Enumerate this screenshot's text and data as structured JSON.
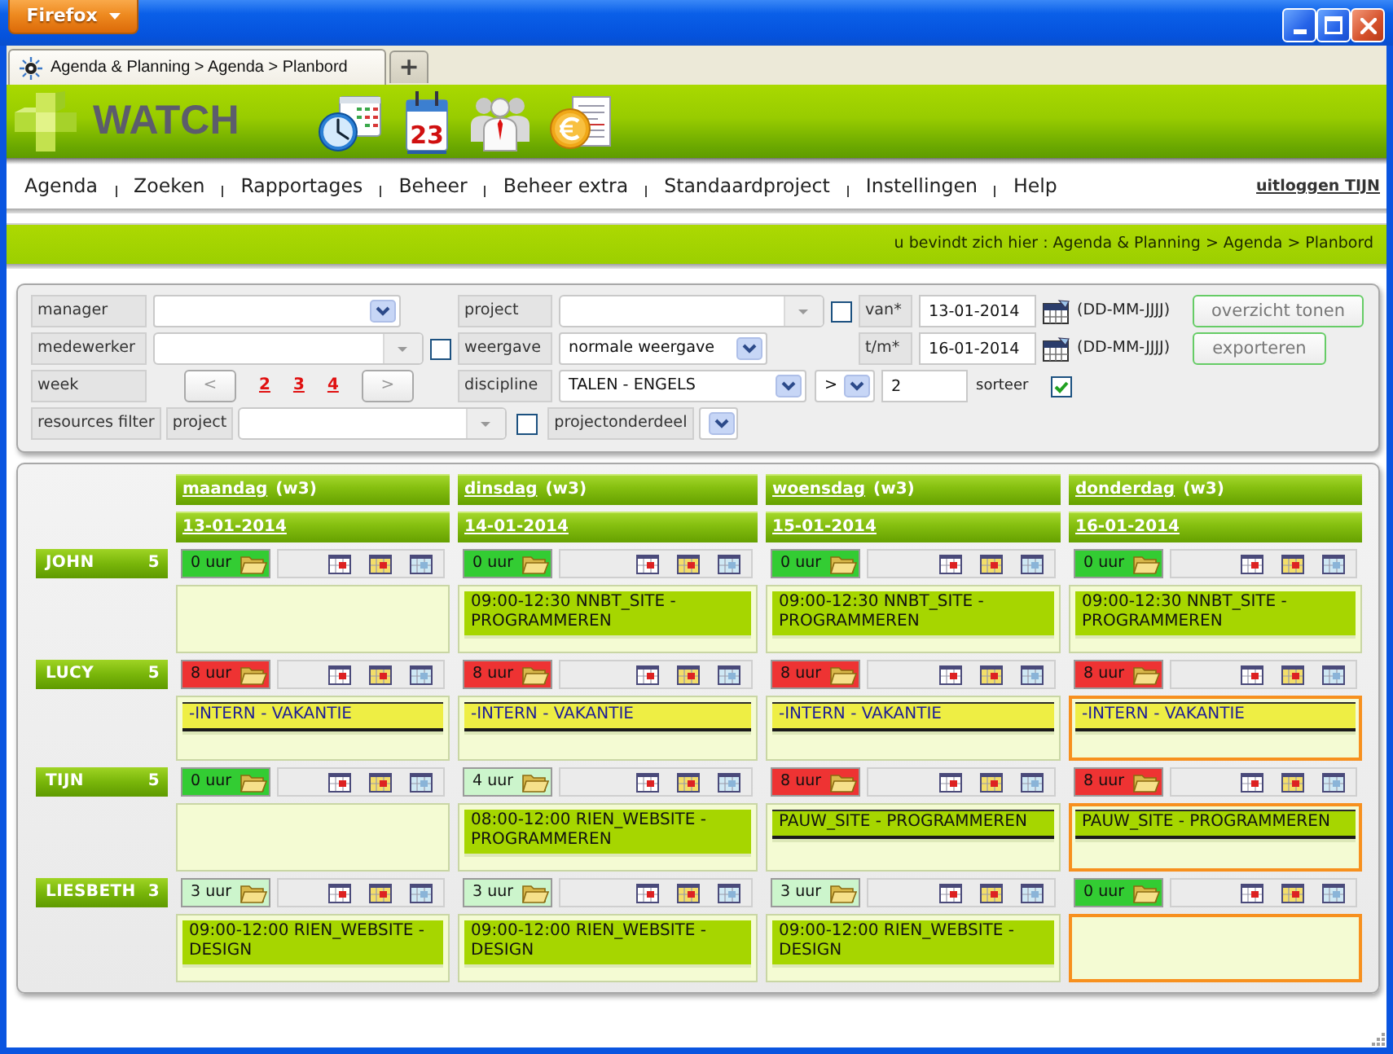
{
  "window": {
    "menu_button": "Firefox"
  },
  "browser_tab": {
    "title": "Agenda & Planning > Agenda > Planbord",
    "new_tab": "+"
  },
  "header": {
    "logo": "WATCH",
    "calendar_day": "23"
  },
  "nav": {
    "items": [
      "Agenda",
      "Zoeken",
      "Rapportages",
      "Beheer",
      "Beheer extra",
      "Standaardproject",
      "Instellingen",
      "Help"
    ],
    "logout": "uitloggen TIJN"
  },
  "breadcrumb": "u bevindt zich hier : Agenda & Planning > Agenda > Planbord",
  "filters": {
    "manager": {
      "label": "manager",
      "kind": "dropdown"
    },
    "employee": {
      "label": "medewerker",
      "kind": "combobox",
      "checked": false
    },
    "week": {
      "label": "week",
      "prev": "<",
      "next": ">",
      "pages": [
        "2",
        "3",
        "4"
      ]
    },
    "resources_filter": {
      "label": "resources filter",
      "project": {
        "label": "project",
        "kind": "combobox",
        "checked": false
      },
      "part": {
        "label": "projectonderdeel",
        "kind": "dropdown"
      }
    },
    "project": {
      "label": "project",
      "kind": "combobox",
      "checked": false
    },
    "view": {
      "label": "weergave",
      "kind": "dropdown",
      "value": "normale weergave"
    },
    "discipline": {
      "label": "discipline",
      "kind": "dropdown",
      "value": "TALEN - ENGELS",
      "operator": ">",
      "count": "2",
      "sort_label": "sorteer",
      "sort_checked": true
    },
    "date_from": {
      "label": "van*",
      "value": "13-01-2014",
      "format": "(DD-MM-JJJJ)"
    },
    "date_to": {
      "label": "t/m*",
      "value": "16-01-2014",
      "format": "(DD-MM-JJJJ)"
    },
    "buttons": [
      "overzicht tonen",
      "exporteren"
    ]
  },
  "planner": {
    "days": [
      {
        "day": "maandag",
        "week": "(w3)",
        "date": "13-01-2014"
      },
      {
        "day": "dinsdag",
        "week": "(w3)",
        "date": "14-01-2014"
      },
      {
        "day": "woensdag",
        "week": "(w3)",
        "date": "15-01-2014"
      },
      {
        "day": "donderdag",
        "week": "(w3)",
        "date": "16-01-2014"
      }
    ],
    "people": [
      {
        "name": "JOHN",
        "count": "5",
        "days": [
          {
            "hours": "0 uur",
            "color": "#33cc33",
            "highlighted": false
          },
          {
            "hours": "0 uur",
            "color": "#33cc33",
            "highlighted": false,
            "entries": [
              {
                "kind": "timed",
                "color": "#a6d600",
                "text": "09:00-12:30 NNBT_SITE - PROGRAMMEREN"
              }
            ]
          },
          {
            "hours": "0 uur",
            "color": "#33cc33",
            "highlighted": false,
            "entries": [
              {
                "kind": "timed",
                "color": "#a6d600",
                "text": "09:00-12:30 NNBT_SITE - PROGRAMMEREN"
              }
            ]
          },
          {
            "hours": "0 uur",
            "color": "#33cc33",
            "highlighted": false,
            "entries": [
              {
                "kind": "timed",
                "color": "#a6d600",
                "text": "09:00-12:30 NNBT_SITE - PROGRAMMEREN"
              }
            ]
          }
        ]
      },
      {
        "name": "LUCY",
        "count": "5",
        "days": [
          {
            "hours": "8 uur",
            "color": "#ee3333",
            "highlighted": false,
            "entries": [
              {
                "kind": "absence",
                "color": "#eeee44",
                "text": "-INTERN - VAKANTIE"
              }
            ]
          },
          {
            "hours": "8 uur",
            "color": "#ee3333",
            "highlighted": false,
            "entries": [
              {
                "kind": "absence",
                "color": "#eeee44",
                "text": "-INTERN - VAKANTIE"
              }
            ]
          },
          {
            "hours": "8 uur",
            "color": "#ee3333",
            "highlighted": false,
            "entries": [
              {
                "kind": "absence",
                "color": "#eeee44",
                "text": "-INTERN - VAKANTIE"
              }
            ]
          },
          {
            "hours": "8 uur",
            "color": "#ee3333",
            "highlighted": true,
            "entries": [
              {
                "kind": "absence",
                "color": "#eeee44",
                "text": "-INTERN - VAKANTIE"
              }
            ]
          }
        ]
      },
      {
        "name": "TIJN",
        "count": "5",
        "days": [
          {
            "hours": "0 uur",
            "color": "#33cc33",
            "highlighted": false
          },
          {
            "hours": "4 uur",
            "color": "#ccf5cc",
            "highlighted": false,
            "entries": [
              {
                "kind": "timed",
                "color": "#a6d600",
                "text": "08:00-12:00 RIEN_WEBSITE - PROGRAMMEREN"
              }
            ]
          },
          {
            "hours": "8 uur",
            "color": "#ee3333",
            "highlighted": false,
            "entries": [
              {
                "kind": "allday",
                "color": "#a6d600",
                "text": "PAUW_SITE - PROGRAMMEREN"
              }
            ]
          },
          {
            "hours": "8 uur",
            "color": "#ee3333",
            "highlighted": true,
            "entries": [
              {
                "kind": "allday",
                "color": "#a6d600",
                "text": "PAUW_SITE - PROGRAMMEREN"
              }
            ]
          }
        ]
      },
      {
        "name": "LIESBETH",
        "count": "3",
        "days": [
          {
            "hours": "3 uur",
            "color": "#ccf5cc",
            "highlighted": false,
            "entries": [
              {
                "kind": "timed",
                "color": "#a6d600",
                "text": "09:00-12:00 RIEN_WEBSITE - DESIGN"
              }
            ]
          },
          {
            "hours": "3 uur",
            "color": "#ccf5cc",
            "highlighted": false,
            "entries": [
              {
                "kind": "timed",
                "color": "#a6d600",
                "text": "09:00-12:00 RIEN_WEBSITE - DESIGN"
              }
            ]
          },
          {
            "hours": "3 uur",
            "color": "#ccf5cc",
            "highlighted": false,
            "entries": [
              {
                "kind": "timed",
                "color": "#a6d600",
                "text": "09:00-12:00 RIEN_WEBSITE - DESIGN"
              }
            ]
          },
          {
            "hours": "0 uur",
            "color": "#33cc33",
            "highlighted": true
          }
        ]
      }
    ]
  }
}
